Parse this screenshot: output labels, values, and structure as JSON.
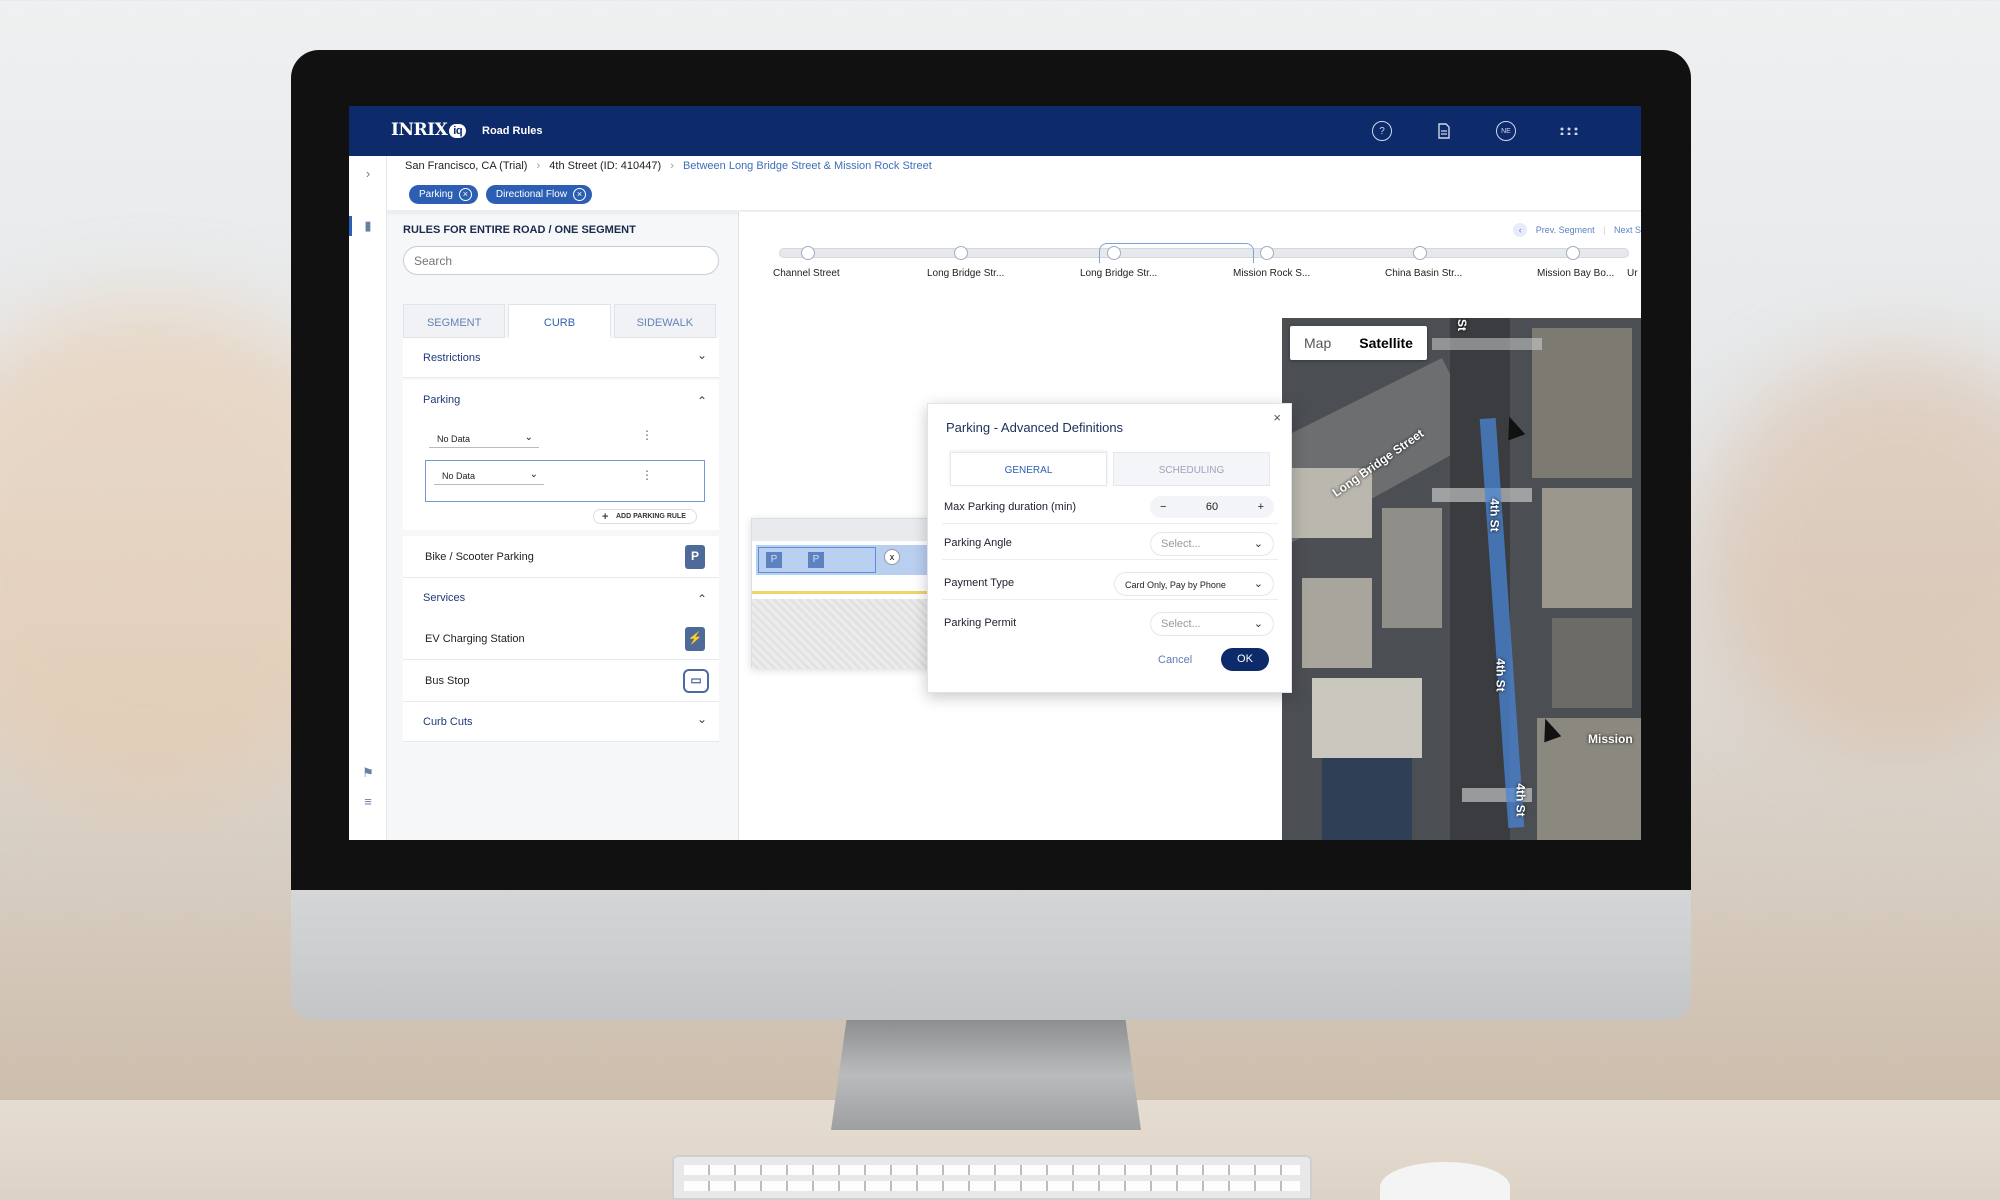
{
  "topbar": {
    "logo": "INRIX",
    "logo_badge": "iq",
    "app_name": "Road Rules",
    "icons": [
      "help-icon",
      "document-icon",
      "user-avatar-icon",
      "apps-grid-icon"
    ],
    "user_initials": "NE"
  },
  "breadcrumb": {
    "city": "San Francisco, CA (Trial)",
    "street": "4th Street (ID: 410447)",
    "segment": "Between Long Bridge Street & Mission Rock Street"
  },
  "filters": [
    "Parking",
    "Directional Flow"
  ],
  "panel": {
    "title": "RULES FOR ENTIRE ROAD / ONE SEGMENT",
    "search_placeholder": "Search",
    "tabs": [
      "SEGMENT",
      "CURB",
      "SIDEWALK"
    ],
    "active_tab": "CURB",
    "sections": {
      "restrictions": "Restrictions",
      "parking": "Parking",
      "services": "Services",
      "curb_cuts": "Curb Cuts"
    },
    "parking_rules": [
      "No Data",
      "No Data"
    ],
    "add_rule": "ADD PARKING RULE",
    "bike_scooter": "Bike / Scooter Parking",
    "ev_charging": "EV Charging Station",
    "bus_stop": "Bus Stop"
  },
  "segments": {
    "prev": "Prev. Segment",
    "next": "Next S",
    "nodes": [
      "Channel Street",
      "Long Bridge Str...",
      "Long Bridge Str...",
      "Mission Rock S...",
      "China Basin Str...",
      "Mission Bay Bo...",
      "Ur"
    ]
  },
  "dialog": {
    "title": "Parking - Advanced Definitions",
    "tabs": [
      "GENERAL",
      "SCHEDULING"
    ],
    "active_tab": "GENERAL",
    "max_duration_label": "Max Parking duration (min)",
    "max_duration_value": "60",
    "angle_label": "Parking Angle",
    "angle_value": "Select...",
    "payment_label": "Payment Type",
    "payment_value": "Card Only, Pay by Phone",
    "permit_label": "Parking Permit",
    "permit_value": "Select...",
    "cancel": "Cancel",
    "ok": "OK"
  },
  "map": {
    "toggle": [
      "Map",
      "Satellite"
    ],
    "active": "Satellite",
    "labels": [
      "Long Bridge Street",
      "4th St",
      "4th St",
      "4th St",
      "Mission",
      "St"
    ]
  },
  "colors": {
    "brand_navy": "#0d2a6b",
    "accent_blue": "#2c5fb3",
    "route_blue": "#4a86d6"
  }
}
